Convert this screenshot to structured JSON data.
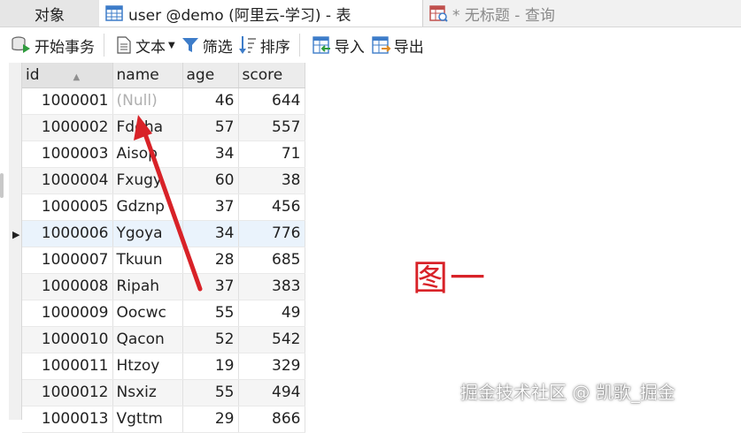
{
  "tabs": {
    "objects": "对象",
    "active": "user @demo (阿里云-学习) - 表",
    "inactive": "* 无标题 - 查询"
  },
  "toolbar": {
    "begin_transaction": "开始事务",
    "text": "文本",
    "filter": "筛选",
    "sort": "排序",
    "import": "导入",
    "export": "导出"
  },
  "grid": {
    "columns": [
      "id",
      "name",
      "age",
      "score"
    ],
    "rows": [
      {
        "id": "1000001",
        "name": "(Null)",
        "age": "46",
        "score": "644"
      },
      {
        "id": "1000002",
        "name": "Fdqha",
        "age": "57",
        "score": "557"
      },
      {
        "id": "1000003",
        "name": "Aisop",
        "age": "34",
        "score": "71"
      },
      {
        "id": "1000004",
        "name": "Fxugy",
        "age": "60",
        "score": "38"
      },
      {
        "id": "1000005",
        "name": "Gdznp",
        "age": "37",
        "score": "456"
      },
      {
        "id": "1000006",
        "name": "Ygoya",
        "age": "34",
        "score": "776"
      },
      {
        "id": "1000007",
        "name": "Tkuun",
        "age": "28",
        "score": "685"
      },
      {
        "id": "1000008",
        "name": "Ripah",
        "age": "37",
        "score": "383"
      },
      {
        "id": "1000009",
        "name": "Oocwc",
        "age": "55",
        "score": "49"
      },
      {
        "id": "1000010",
        "name": "Qacon",
        "age": "52",
        "score": "542"
      },
      {
        "id": "1000011",
        "name": "Htzoy",
        "age": "19",
        "score": "329"
      },
      {
        "id": "1000012",
        "name": "Nsxiz",
        "age": "55",
        "score": "494"
      },
      {
        "id": "1000013",
        "name": "Vgttm",
        "age": "29",
        "score": "866"
      }
    ]
  },
  "annotation": {
    "label": "图一",
    "color": "#d82228"
  },
  "watermark": "掘金技术社区 @ 凯歌_掘金",
  "icons": {
    "table_tab": "table-icon",
    "query_tab": "query-icon",
    "begin_transaction": "transaction-icon",
    "text": "document-icon",
    "filter": "filter-icon",
    "sort": "sort-icon",
    "import": "import-icon",
    "export": "export-icon"
  }
}
